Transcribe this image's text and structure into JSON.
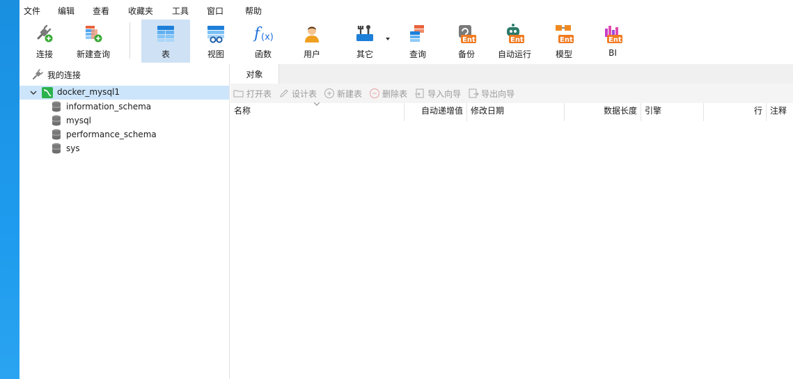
{
  "menubar": {
    "items": [
      "文件",
      "编辑",
      "查看",
      "收藏夹",
      "工具",
      "窗口",
      "帮助"
    ]
  },
  "toolbar": {
    "buttons": [
      {
        "label": "连接",
        "icon": "plug-icon"
      },
      {
        "label": "新建查询",
        "icon": "new-query-icon"
      },
      {
        "label": "表",
        "icon": "table-icon"
      },
      {
        "label": "视图",
        "icon": "view-icon"
      },
      {
        "label": "函数",
        "icon": "function-icon"
      },
      {
        "label": "用户",
        "icon": "user-icon"
      },
      {
        "label": "其它",
        "icon": "tools-icon"
      },
      {
        "label": "查询",
        "icon": "query-icon"
      },
      {
        "label": "备份",
        "icon": "backup-icon",
        "badge": "Ent"
      },
      {
        "label": "自动运行",
        "icon": "robot-icon",
        "badge": "Ent"
      },
      {
        "label": "模型",
        "icon": "model-icon",
        "badge": "Ent"
      },
      {
        "label": "BI",
        "icon": "bi-chart-icon",
        "badge": "Ent"
      }
    ],
    "active": "表"
  },
  "sidebar": {
    "header": "我的连接",
    "connection": "docker_mysql1",
    "databases": [
      "information_schema",
      "mysql",
      "performance_schema",
      "sys"
    ]
  },
  "main": {
    "tab": "对象",
    "actions": [
      "打开表",
      "设计表",
      "新建表",
      "删除表",
      "导入向导",
      "导出向导"
    ],
    "columns": [
      "名称",
      "自动递增值",
      "修改日期",
      "数据长度",
      "引擎",
      "行",
      "注释"
    ]
  },
  "colors": {
    "accent": "#1e6fd9",
    "selected_row": "#cce5fb",
    "active_tool": "#cfe2f5",
    "desktop": "#1e9bee"
  }
}
